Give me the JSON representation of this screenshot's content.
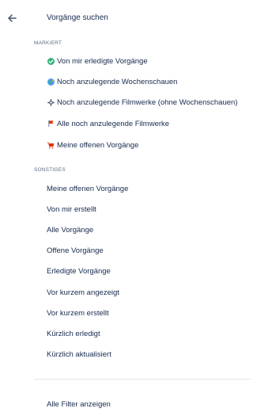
{
  "header": {
    "title": "Vorgänge suchen",
    "back_icon": "arrow-left-icon"
  },
  "sections": {
    "markiert": {
      "label": "MARKIERT",
      "items": [
        {
          "label": "Von mir erledigte Vorgänge",
          "icon": "check-circle-icon",
          "color": "#36b37e"
        },
        {
          "label": "Noch anzulegende Wochenschauen",
          "icon": "globe-icon",
          "color": "#ffab00"
        },
        {
          "label": "Noch anzulegende Filmwerke (ohne Wochenschauen)",
          "icon": "sparkle-icon",
          "color": "#42526e"
        },
        {
          "label": "Alle noch anzulegende Filmwerke",
          "icon": "flag-icon",
          "color": "#de350b"
        },
        {
          "label": "Meine offenen Vorgänge",
          "icon": "cart-icon",
          "color": "#de350b"
        }
      ]
    },
    "sonstiges": {
      "label": "SONSTIGES",
      "items": [
        "Meine offenen Vorgänge",
        "Von mir erstellt",
        "Alle Vorgänge",
        "Offene Vorgänge",
        "Erledigte Vorgänge",
        "Vor kurzem angezeigt",
        "Vor kurzem erstellt",
        "Kürzlich erledigt",
        "Kürzlich aktualisiert"
      ]
    }
  },
  "footer": {
    "all_filters": "Alle Filter anzeigen"
  }
}
